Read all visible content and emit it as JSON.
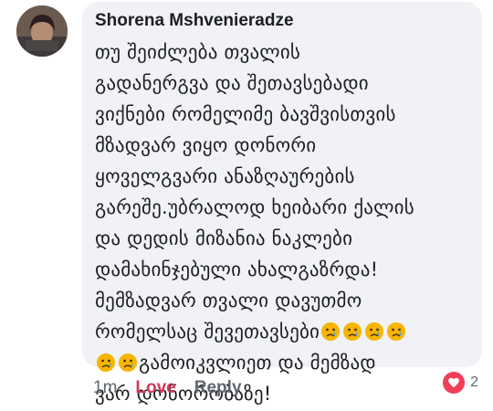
{
  "author": {
    "name": "Shorena Mshvenieradze"
  },
  "comment": {
    "line1": "თუ შეიძლება თვალის",
    "line2": "გადანერგვა და შეთავსებადი",
    "line3": "ვიქნები რომელიმე ბავშვისთვის",
    "line4": "მზადვარ ვიყო დონორი",
    "line5": "ყოველგვარი ანაზღაურების",
    "line6": "გარეშე.უბრალოდ ხეიბარი ქალის",
    "line7": "და დედის მიზანია ნაკლები",
    "line8": "დამახინჯებული ახალგაზრდა!",
    "line9": "მემზადვარ თვალი დავუთმო",
    "line10": "რომელსაც შევეთავსები",
    "line11": "გამოიკვლიეთ და მემზად",
    "line12": "ვარ დონორობაზე!"
  },
  "actions": {
    "time": "1m",
    "love": "Love",
    "reply": "Reply"
  },
  "reactions": {
    "count": "2",
    "icon": "heart-icon",
    "color": "#f33e58"
  },
  "emoji": {
    "icon": "crying-face-icon",
    "color": "#f7b500"
  }
}
